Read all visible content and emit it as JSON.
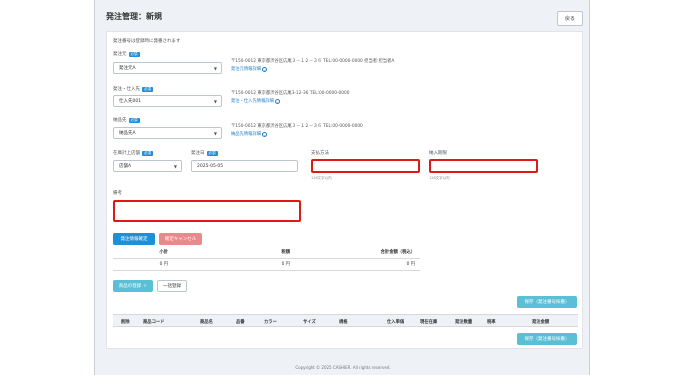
{
  "header": {
    "title": "発注管理：新規",
    "back_label": "戻る"
  },
  "form": {
    "notice": "発注番号は登録時に発番されます",
    "required_badge": "必須",
    "supplier": {
      "label": "発注元",
      "value": "発注元A",
      "address": "〒150-0012 東京都渋谷区広尾３－１２－３６  TEL:00-0000-0000  担当者:担当者A",
      "link": "発注元情報詳細"
    },
    "vendor": {
      "label": "発注・仕入先",
      "value": "仕入先001",
      "address": "〒150-0012 東京都渋谷区広尾3-12-36  TEL:00-0000-0000",
      "link": "発注・仕入先情報詳細"
    },
    "delivery": {
      "label": "納品先",
      "value": "納品先A",
      "address": "〒150-0012 東京都渋谷区広尾３－１２－３６  TEL:00-0000-0000",
      "link": "納品先情報詳細"
    },
    "store": {
      "label": "在庫計上店舗",
      "value": "店舗A"
    },
    "order_date": {
      "label": "発注日",
      "value": "2025-05-05"
    },
    "payment": {
      "label": "支払方法",
      "hint": "128文字以内"
    },
    "delivery_period": {
      "label": "納入期限",
      "hint": "128文字以内"
    },
    "remarks": {
      "label": "備考"
    }
  },
  "actions": {
    "confirm": "発注情報確定",
    "cancel": "確定キャンセル",
    "add_product": "商品の登録 ＋",
    "bulk_register": "一括登録",
    "save_top": "保存（発注番号採番）",
    "save_bottom": "保存（発注番号採番）"
  },
  "summary": {
    "headers": [
      "小計",
      "税額",
      "合計金額（税込）"
    ],
    "values": [
      "0 円",
      "0 円",
      "0 円"
    ]
  },
  "items_table": {
    "headers": [
      "削除",
      "商品コード",
      "商品名",
      "品番",
      "カラー",
      "サイズ",
      "規格",
      "仕入単価",
      "現在在庫",
      "発注数量",
      "税率",
      "発注金額"
    ]
  },
  "footer": {
    "copyright": "Copyright © 2025 CASHIER. All rights reserved."
  },
  "colors": {
    "primary": "#1f8fd6",
    "danger_soft": "#e98a8a",
    "teal": "#5bbfd6",
    "highlight": "#e01818"
  }
}
